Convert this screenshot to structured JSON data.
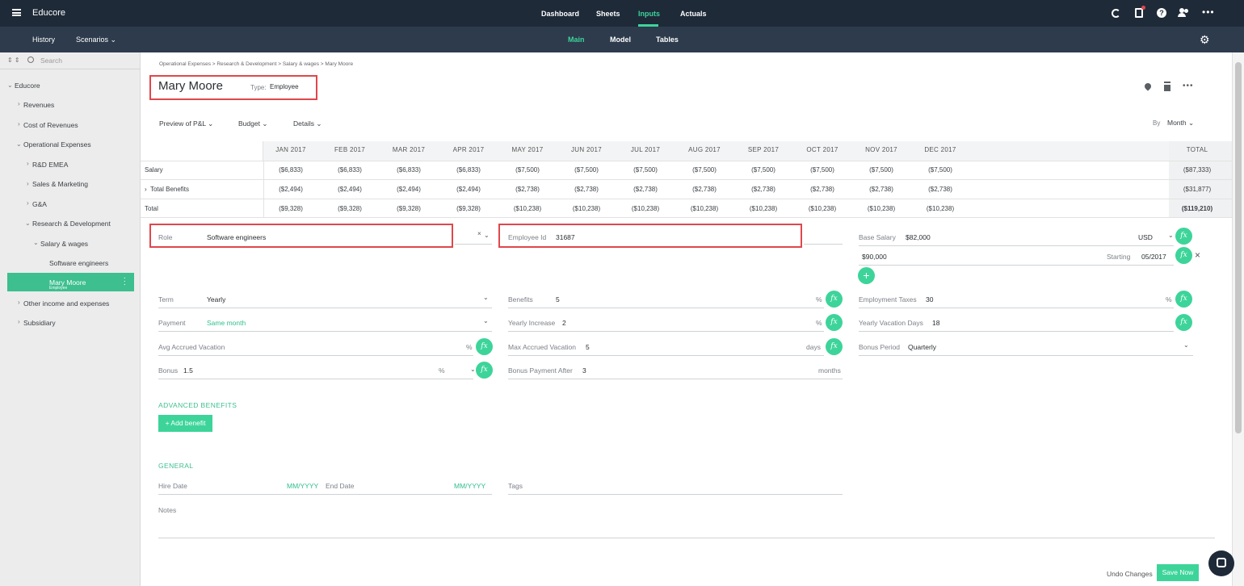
{
  "app": {
    "title": "Educore"
  },
  "topnav": {
    "tabs": [
      "Dashboard",
      "Sheets",
      "Inputs",
      "Actuals"
    ],
    "active": "Inputs"
  },
  "subnav": {
    "history": "History",
    "scenarios": "Scenarios",
    "tabs": [
      "Main",
      "Model",
      "Tables"
    ],
    "active": "Main"
  },
  "sidebar": {
    "search_placeholder": "Search",
    "items": [
      {
        "label": "Educore"
      },
      {
        "label": "Revenues"
      },
      {
        "label": "Cost of Revenues"
      },
      {
        "label": "Operational Expenses"
      },
      {
        "label": "R&D EMEA"
      },
      {
        "label": "Sales & Marketing"
      },
      {
        "label": "G&A"
      },
      {
        "label": "Research & Development"
      },
      {
        "label": "Salary & wages"
      },
      {
        "label": "Software engineers"
      },
      {
        "label": "Mary Moore",
        "sublabel": "Employee",
        "selected": true
      },
      {
        "label": "Other income and expenses"
      },
      {
        "label": "Subsidiary"
      }
    ]
  },
  "breadcrumb": "Operational Expenses > Research & Development > Salary & wages > Mary Moore",
  "header": {
    "name": "Mary Moore",
    "type_label": "Type:",
    "type_value": "Employee"
  },
  "filters": {
    "preview": "Preview of P&L",
    "budget": "Budget",
    "details": "Details",
    "by_label": "By",
    "by_value": "Month"
  },
  "table": {
    "months": [
      "JAN 2017",
      "FEB 2017",
      "MAR 2017",
      "APR 2017",
      "MAY 2017",
      "JUN 2017",
      "JUL 2017",
      "AUG 2017",
      "SEP 2017",
      "OCT 2017",
      "NOV 2017",
      "DEC 2017"
    ],
    "total_header": "TOTAL",
    "rows": [
      {
        "label": "Salary",
        "values": [
          "($6,833)",
          "($6,833)",
          "($6,833)",
          "($6,833)",
          "($7,500)",
          "($7,500)",
          "($7,500)",
          "($7,500)",
          "($7,500)",
          "($7,500)",
          "($7,500)",
          "($7,500)"
        ],
        "total": "($87,333)"
      },
      {
        "label": "Total Benefits",
        "values": [
          "($2,494)",
          "($2,494)",
          "($2,494)",
          "($2,494)",
          "($2,738)",
          "($2,738)",
          "($2,738)",
          "($2,738)",
          "($2,738)",
          "($2,738)",
          "($2,738)",
          "($2,738)"
        ],
        "total": "($31,877)"
      },
      {
        "label": "Total",
        "values": [
          "($9,328)",
          "($9,328)",
          "($9,328)",
          "($9,328)",
          "($10,238)",
          "($10,238)",
          "($10,238)",
          "($10,238)",
          "($10,238)",
          "($10,238)",
          "($10,238)",
          "($10,238)"
        ],
        "total": "($119,210)"
      }
    ]
  },
  "form": {
    "role": {
      "label": "Role",
      "value": "Software engineers"
    },
    "employee_id": {
      "label": "Employee Id",
      "value": "31687"
    },
    "base_salary": {
      "label": "Base Salary",
      "value": "$82,000",
      "currency": "USD"
    },
    "salary_change": {
      "value": "$90,000",
      "starting_label": "Starting",
      "starting_value": "05/2017"
    },
    "term": {
      "label": "Term",
      "value": "Yearly"
    },
    "payment": {
      "label": "Payment",
      "value": "Same month"
    },
    "avg_vacation": {
      "label": "Avg Accrued Vacation",
      "unit": "%"
    },
    "bonus": {
      "label": "Bonus",
      "value": "1.5",
      "unit": "%"
    },
    "benefits": {
      "label": "Benefits",
      "value": "5",
      "unit": "%"
    },
    "yearly_increase": {
      "label": "Yearly Increase",
      "value": "2",
      "unit": "%"
    },
    "max_vacation": {
      "label": "Max Accrued Vacation",
      "value": "5",
      "unit": "days"
    },
    "bonus_after": {
      "label": "Bonus Payment After",
      "value": "3",
      "unit": "months"
    },
    "employment_taxes": {
      "label": "Employment Taxes",
      "value": "30",
      "unit": "%"
    },
    "vacation_days": {
      "label": "Yearly Vacation Days",
      "value": "18"
    },
    "bonus_period": {
      "label": "Bonus Period",
      "value": "Quarterly"
    }
  },
  "advanced": {
    "title": "ADVANCED BENEFITS",
    "add_button": "+ Add benefit"
  },
  "general": {
    "title": "GENERAL",
    "hire_date": {
      "label": "Hire Date",
      "placeholder": "MM/YYYY"
    },
    "end_date": {
      "label": "End Date",
      "placeholder": "MM/YYYY"
    },
    "tags": {
      "label": "Tags"
    },
    "notes": {
      "label": "Notes"
    }
  },
  "footer": {
    "undo": "Undo Changes",
    "save": "Save Now"
  },
  "colors": {
    "accent": "#3dd49a",
    "topbar": "#1e2a38",
    "subbar": "#2d3b4c",
    "highlight": "#e0474c"
  }
}
